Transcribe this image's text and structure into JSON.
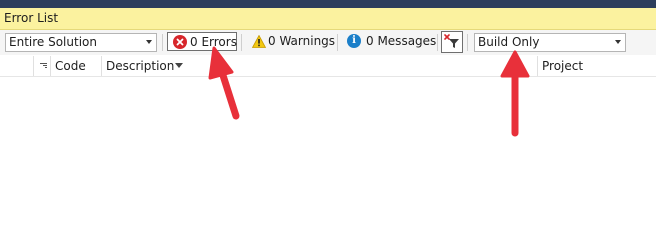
{
  "panel": {
    "title": "Error List"
  },
  "toolbar": {
    "scope_value": "Entire Solution",
    "errors_label": "0 Errors",
    "warnings_label": "0 Warnings",
    "messages_label": "0 Messages",
    "source_value": "Build Only"
  },
  "columns": {
    "code": "Code",
    "description": "Description",
    "project": "Project"
  },
  "colors": {
    "accent_band": "#2d3e5c",
    "title_background": "#fbf29f",
    "error_icon": "#d7262b",
    "warning_icon": "#f2c811",
    "info_icon": "#1b7fc9",
    "annotation_arrow": "#e8303a"
  }
}
